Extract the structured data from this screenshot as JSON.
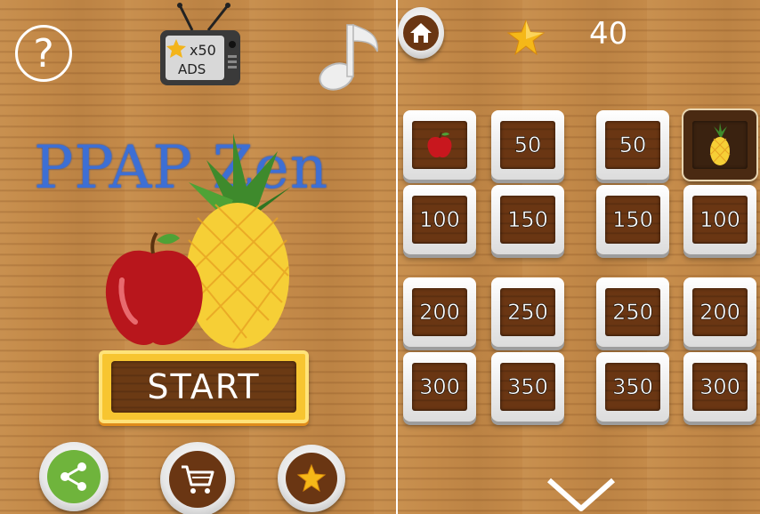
{
  "left": {
    "title": "PPAP Zen",
    "help_label": "?",
    "ads": {
      "multiplier": "x50",
      "label": "ADS"
    },
    "start_label": "START",
    "bottom_buttons": [
      "share-icon",
      "cart-icon",
      "star-icon"
    ]
  },
  "right": {
    "score": "40",
    "tiles": [
      {
        "label": "",
        "icon": "apple"
      },
      {
        "label": "50"
      },
      {
        "label": "50"
      },
      {
        "label": "",
        "icon": "pineapple",
        "selected": true
      },
      {
        "label": "100"
      },
      {
        "label": "150"
      },
      {
        "label": "150"
      },
      {
        "label": "100"
      },
      {
        "label": "200"
      },
      {
        "label": "250"
      },
      {
        "label": "250"
      },
      {
        "label": "200"
      },
      {
        "label": "300"
      },
      {
        "label": "350"
      },
      {
        "label": "350"
      },
      {
        "label": "300"
      }
    ]
  },
  "colors": {
    "title": "#3d6fd4",
    "start_frame": "#f7c531",
    "wood": "#6a3613",
    "share_green": "#6fb43c"
  }
}
